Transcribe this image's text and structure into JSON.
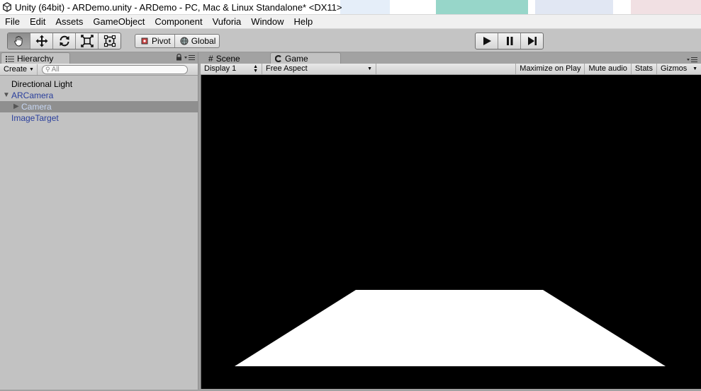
{
  "window": {
    "title": "Unity (64bit) - ARDemo.unity - ARDemo - PC, Mac & Linux Standalone* <DX11>"
  },
  "menu": [
    "File",
    "Edit",
    "Assets",
    "GameObject",
    "Component",
    "Vuforia",
    "Window",
    "Help"
  ],
  "toolbar": {
    "tools": [
      "hand-icon",
      "move-icon",
      "rotate-icon",
      "scale-icon",
      "rect-icon"
    ],
    "active_tool": "hand-icon",
    "pivot_label": "Pivot",
    "global_label": "Global",
    "play": [
      "play-icon",
      "pause-icon",
      "step-icon"
    ]
  },
  "hierarchy": {
    "tab_label": "Hierarchy",
    "create_label": "Create",
    "search_placeholder": "All",
    "items": [
      {
        "label": "Directional Light",
        "depth": 0,
        "blue": false,
        "expander": "",
        "selected": false
      },
      {
        "label": "ARCamera",
        "depth": 0,
        "blue": true,
        "expander": "▼",
        "selected": false
      },
      {
        "label": "Camera",
        "depth": 1,
        "blue": true,
        "expander": "▶",
        "selected": true
      },
      {
        "label": "ImageTarget",
        "depth": 0,
        "blue": true,
        "expander": "",
        "selected": false
      }
    ]
  },
  "views": {
    "scene_tab": "Scene",
    "game_tab": "Game",
    "display_label": "Display 1",
    "aspect_label": "Free Aspect",
    "maximize_label": "Maximize on Play",
    "mute_label": "Mute audio",
    "stats_label": "Stats",
    "gizmos_label": "Gizmos"
  },
  "colors": {
    "game_background": "#000000",
    "plane_fill": "#ffffff",
    "hierarchy_link": "#2a3f9c",
    "selection": "#8f8f8f"
  }
}
